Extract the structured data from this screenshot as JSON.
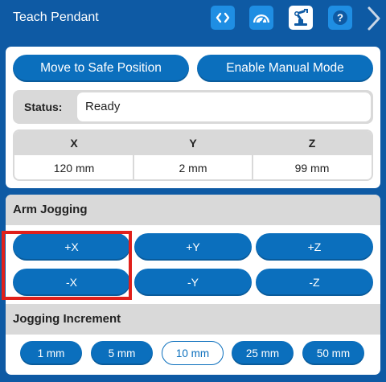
{
  "header": {
    "title": "Teach Pendant",
    "icons": [
      "code-icon",
      "speedometer-icon",
      "robot-arm-icon",
      "help-icon",
      "chevron-right-icon"
    ],
    "active_icon": "robot-arm-icon"
  },
  "actions": {
    "safe_position": "Move to Safe Position",
    "manual_mode": "Enable Manual Mode"
  },
  "status": {
    "label": "Status:",
    "value": "Ready"
  },
  "coordinates": {
    "headers": [
      "X",
      "Y",
      "Z"
    ],
    "values": [
      "120 mm",
      "2 mm",
      "99 mm"
    ]
  },
  "jogging": {
    "title": "Arm Jogging",
    "buttons": [
      "+X",
      "+Y",
      "+Z",
      "-X",
      "-Y",
      "-Z"
    ]
  },
  "increment": {
    "title": "Jogging Increment",
    "options": [
      "1 mm",
      "5 mm",
      "10 mm",
      "25 mm",
      "50 mm"
    ],
    "selected": "10 mm"
  },
  "colors": {
    "header_bg": "#0e5aa4",
    "button_blue": "#0b6fbd",
    "accent_light": "#1f8ee3",
    "panel_gray": "#d9d9d9",
    "highlight_red": "#e0201b"
  }
}
